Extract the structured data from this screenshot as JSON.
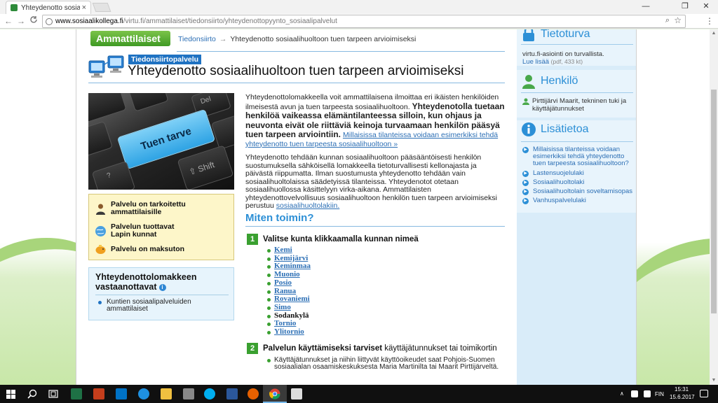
{
  "browser": {
    "tab_title": "Yhteydenotto sosiaalihuo",
    "tab_close": "×",
    "url_host": "www.sosiaalikollega.fi",
    "url_path": "/virtu.fi/ammattilaiset/tiedonsiirto/yhteydenottopyynto_sosiaalipalvelut",
    "window_minimize": "—",
    "window_restore": "❐",
    "window_close": "✕",
    "back": "←",
    "forward": "→",
    "reload": "C"
  },
  "page": {
    "ammattilaiset_button": "Ammattilaiset →",
    "breadcrumb": {
      "link": "Tiedonsiirto",
      "arrow": "→",
      "current": "Yhteydenotto sosiaalihuoltoon tuen tarpeen arvioimiseksi"
    },
    "badge": "Tiedonsiirtopalvelu",
    "title": "Yhteydenotto sosiaalihuoltoon tuen tarpeen arvioimiseksi",
    "image_key_labels": {
      "main": "Tuen tarve",
      "shift": "⇧ Shift",
      "del": "Del",
      "q": "?"
    },
    "infobox": {
      "row1": "Palvelu on tarkoitettu ammattilaisille",
      "row2": "Palvelun tuottavat Lapin kunnat",
      "row3": "Palvelu on maksuton"
    },
    "receivers": {
      "heading": "Yhteydenottolomakkeen vastaanottavat",
      "info_icon": "i",
      "item": "Kuntien sosiaalipalveluiden ammattilaiset"
    },
    "intro": {
      "normal": "Yhteydenottolomakkeella voit ammattilaisena ilmoittaa eri ikäisten henkilöiden ilmeisestä avun ja tuen tarpeesta sosiaalihuoltoon. ",
      "bold": "Yhteydenotolla tuetaan henkilöä vaikeassa elämäntilanteessa silloin, kun ohjaus ja neuvonta eivät ole riittäviä keinoja turvaamaan henkilön pääsyä tuen tarpeen arviointiin.",
      "link": "Millaisissa tilanteissa voidaan esimerkiksi tehdä yhteydenotto tuen tarpeesta sosiaalihuoltoon »"
    },
    "para2": {
      "text": "Yhteydenotto tehdään kunnan sosiaalihuoltoon pääsääntöisesti henkilön suostumuksella sähköisellä lomakkeella tietoturvallisesti kellonajasta ja päivästä riippumatta. Ilman suostumusta yhteydenotto tehdään vain sosiaalihuoltolaissa säädetyissä tilanteissa. Yhteydenotot otetaan sosiaalihuollossa käsittelyyn virka-aikana. Ammattilaisten yhteydenottovelvollisuus sosiaalihuoltoon henkilön tuen tarpeen arvioimiseksi perustuu ",
      "link": "sosiaalihuoltolakiin."
    },
    "how_heading": "Miten toimin?",
    "step1": {
      "num": "1",
      "label": "Valitse kunta klikkaamalla kunnan nimeä"
    },
    "municipalities": [
      "Kemi",
      "Kemijärvi",
      "Keminmaa",
      "Muonio",
      "Posio",
      "Ranua",
      "Rovaniemi",
      "Simo",
      "Sodankylä",
      "Tornio",
      "Ylitornio"
    ],
    "step2": {
      "num": "2",
      "label_bold": "Palvelun käyttämiseksi tarviset",
      "label_normal": " käyttäjätunnukset tai toimikortin",
      "note": "Käyttäjätunnukset ja niihin liittyvät käyttöoikeudet saat Pohjois-Suomen sosiaalialan osaamiskeskuksesta Maria Martinilta tai Maarit Pirttijärveltä."
    }
  },
  "sidebar": {
    "tietoturva": {
      "title": "Tietoturva",
      "text": "virtu.fi-asiointi on turvallista.",
      "link": "Lue lisää",
      "meta": "(pdf, 433 kt)"
    },
    "henkilo": {
      "title": "Henkilö",
      "text": "Pirttijärvi Maarit, tekninen tuki ja käyttäjätunnukset"
    },
    "lisatietoa": {
      "title": "Lisätietoa",
      "links": [
        "Millaisissa tilanteissa voidaan esimerkiksi tehdä yhteydenotto tuen tarpeesta sosiaalihuoltoon?",
        "Lastensuojelulaki",
        "Sosiaalihuoltolaki",
        "Sosiaalihuoltolain soveltamisopas",
        "Vanhuspalvelulaki"
      ]
    }
  },
  "taskbar": {
    "lang": "FIN",
    "time": "15:31",
    "date": "15.6.2017"
  },
  "colors": {
    "accent_blue": "#2c8fd6",
    "accent_green": "#3aa030",
    "link": "#2c6fb5"
  }
}
